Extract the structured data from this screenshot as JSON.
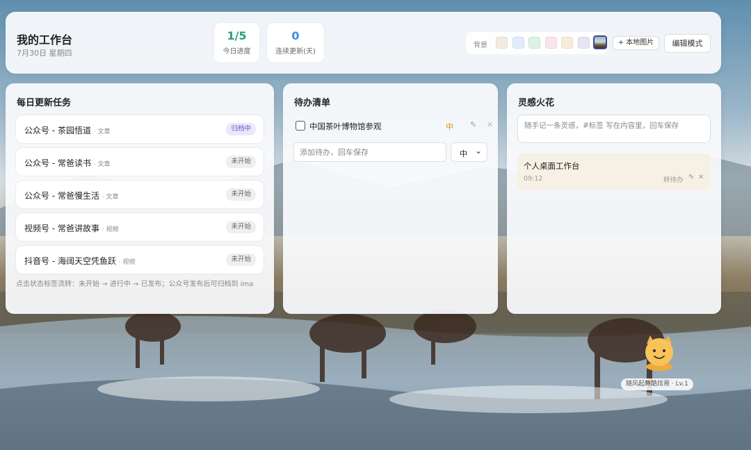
{
  "header": {
    "title": "我的工作台",
    "date": "7月30日 星期四",
    "stats": [
      {
        "value": "1/5",
        "label": "今日进度"
      },
      {
        "value": "0",
        "label": "连续更新(天)"
      }
    ],
    "background_label": "背景",
    "swatch_colors": [
      "#f3ebdf",
      "#e2ecfb",
      "#ddf1e7",
      "#f9e5ec",
      "#f9ecda",
      "#e6e6f3"
    ],
    "local_image_button": "+ 本地图片",
    "edit_mode_button": "编辑模式"
  },
  "tasks": {
    "title": "每日更新任务",
    "items": [
      {
        "name": "公众号 - 茶园悟道",
        "type": "· 文章",
        "status": "归档中"
      },
      {
        "name": "公众号 - 常爸读书",
        "type": "· 文章",
        "status": "未开始"
      },
      {
        "name": "公众号 - 常爸慢生活",
        "type": "· 文章",
        "status": "未开始"
      },
      {
        "name": "视频号 - 常爸讲故事",
        "type": "· 视频",
        "status": "未开始"
      },
      {
        "name": "抖音号 - 海阔天空凭鱼跃",
        "type": "· 视频",
        "status": "未开始"
      }
    ],
    "hint": "点击状态标签流转：未开始 → 进行中 → 已发布；公众号发布后可归档到 ima"
  },
  "todo": {
    "title": "待办清单",
    "items": [
      {
        "text": "中国茶叶博物馆参观",
        "priority": "中",
        "done": false
      }
    ],
    "input_placeholder": "添加待办，回车保存",
    "priority_selected": "中"
  },
  "ideas": {
    "title": "灵感火花",
    "input_placeholder": "随手记一条灵感，#标签 写在内容里，回车保存",
    "items": [
      {
        "text": "个人桌面工作台",
        "time": "09:12",
        "action": "转待办"
      }
    ]
  },
  "pet": {
    "label": "随风起舞酷炫哥 · Lv.1"
  }
}
